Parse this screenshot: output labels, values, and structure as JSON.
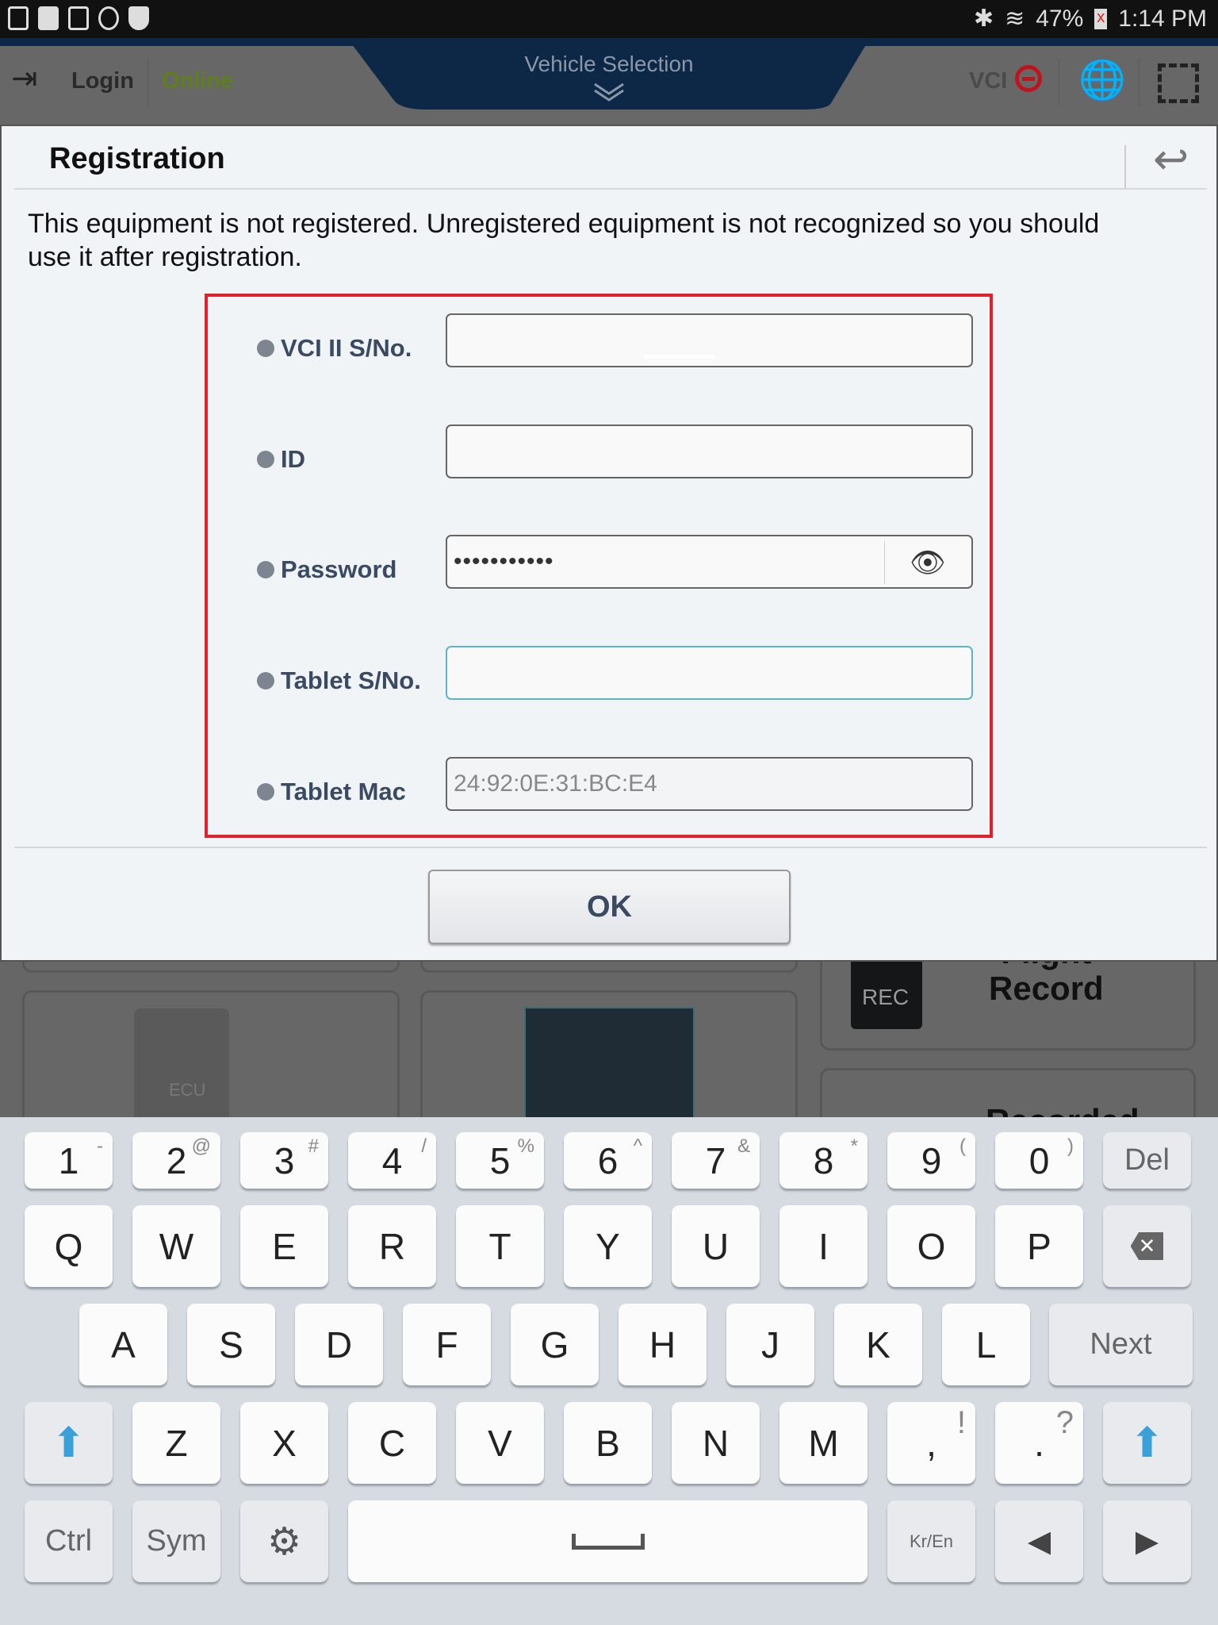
{
  "status_bar": {
    "battery": "47%",
    "time": "1:14 PM",
    "icons": [
      "screen-cast-icon",
      "gmail-icon",
      "gallery-icon",
      "sync-icon",
      "shield-icon",
      "bluetooth-icon",
      "wifi-icon",
      "battery-icon"
    ]
  },
  "header": {
    "login": "Login",
    "online": "Online",
    "vehicle_selection": "Vehicle Selection",
    "vci": "VCI",
    "colors": {
      "online": "#5f7f1c",
      "navy": "#0d2747",
      "vci_status": "#c0141c"
    }
  },
  "background": {
    "rec": "REC",
    "flight": "Flight",
    "record": "Record",
    "recorded": "Recorded",
    "ecu": "ECU"
  },
  "dialog": {
    "title": "Registration",
    "message_line1": "This equipment is not registered. Unregistered equipment is not recognized so you should",
    "message_line2": "use it after registration.",
    "fields": [
      {
        "label": "VCI II S/No.",
        "value": ""
      },
      {
        "label": "ID",
        "value": ""
      },
      {
        "label": "Password",
        "value": "•••••••••••"
      },
      {
        "label": "Tablet S/No.",
        "value": ""
      },
      {
        "label": "Tablet Mac",
        "value": "24:92:0E:31:BC:E4"
      }
    ],
    "ok": "OK",
    "highlight_color": "#e0202a"
  },
  "keyboard": {
    "row1": [
      [
        "1",
        "-"
      ],
      [
        "2",
        "@"
      ],
      [
        "3",
        "#"
      ],
      [
        "4",
        "/"
      ],
      [
        "5",
        "%"
      ],
      [
        "6",
        "^"
      ],
      [
        "7",
        "&"
      ],
      [
        "8",
        "*"
      ],
      [
        "9",
        "("
      ],
      [
        "0",
        ")"
      ]
    ],
    "del": "Del",
    "row2": [
      "Q",
      "W",
      "E",
      "R",
      "T",
      "Y",
      "U",
      "I",
      "O",
      "P"
    ],
    "row3": [
      "A",
      "S",
      "D",
      "F",
      "G",
      "H",
      "J",
      "K",
      "L"
    ],
    "next": "Next",
    "row4": [
      "Z",
      "X",
      "C",
      "V",
      "B",
      "N",
      "M"
    ],
    "comma": [
      ",",
      "!"
    ],
    "period": [
      ".",
      "?"
    ],
    "ctrl": "Ctrl",
    "sym": "Sym",
    "lang": "Kr/En"
  }
}
